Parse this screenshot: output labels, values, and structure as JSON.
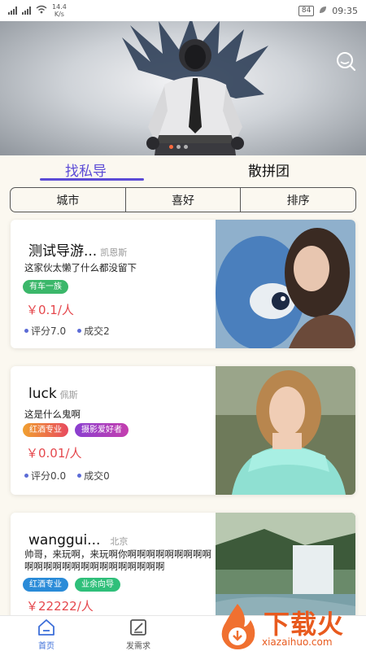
{
  "status_bar": {
    "signal1": "⁴⁶",
    "signal2": "⁴⁶",
    "speed": "14.4",
    "speed_unit": "K/s",
    "battery": "84",
    "time": "09:35"
  },
  "banner": {
    "search_icon": "search-icon",
    "dots": 3,
    "active_dot": 1
  },
  "tabs": {
    "guide": "找私导",
    "group": "散拼团",
    "active": "guide",
    "accent": "#5b4bd6"
  },
  "filters": [
    "城市",
    "喜好",
    "排序"
  ],
  "cards": [
    {
      "name": "测试导游...",
      "location": "凯恩斯",
      "desc": "这家伙太懒了什么都没留下",
      "tags": [
        {
          "text": "有车一族",
          "color": "#3bb76a"
        }
      ],
      "price": "￥0.1/人",
      "rating": "评分7.0",
      "deals": "成交2"
    },
    {
      "name": "luck",
      "location": "佩斯",
      "desc": "这是什么鬼啊",
      "tags": [
        {
          "text": "红酒专业",
          "color": "#f0a030"
        },
        {
          "text": "摄影爱好者",
          "color": "#8a3fd0"
        }
      ],
      "price": "￥0.01/人",
      "rating": "评分0.0",
      "deals": "成交0"
    },
    {
      "name": "wanggui...",
      "location": "北京",
      "desc": "帅哥，来玩啊，来玩啊你啊啊啊啊啊啊啊啊啊啊啊啊啊啊啊啊啊啊啊啊啊啊啊啊",
      "tags": [
        {
          "text": "红酒专业",
          "color": "#2a8bd8"
        },
        {
          "text": "业余向导",
          "color": "#2fbf7a"
        }
      ],
      "price": "￥22222/人",
      "rating": "",
      "deals": ""
    }
  ],
  "bottom_nav": {
    "home": "首页",
    "post": "发需求",
    "active_color": "#3d6fd9"
  },
  "watermark": {
    "text": "下载火",
    "sub": "xiazaihuo.com"
  },
  "colors": {
    "price": "#e5484d",
    "background": "#fbf8f0"
  }
}
